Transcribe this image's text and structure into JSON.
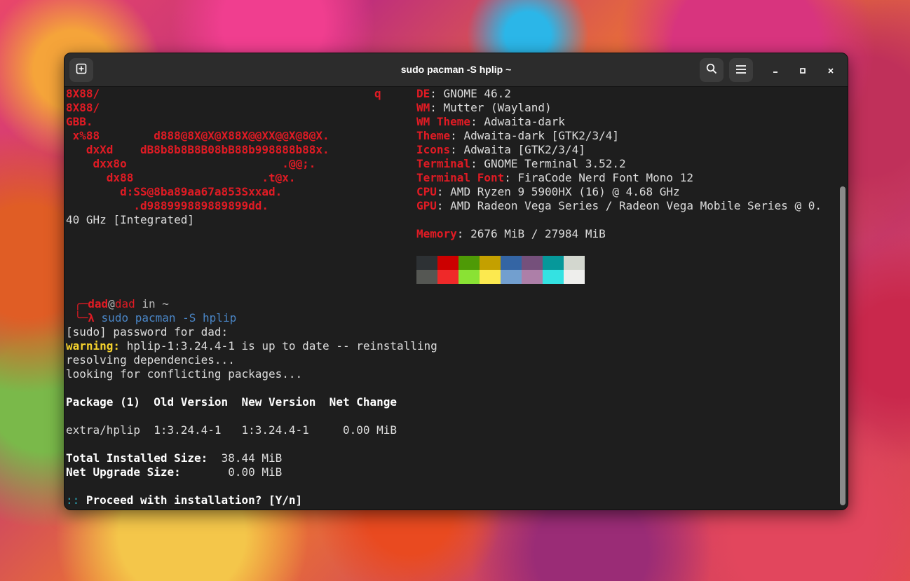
{
  "window": {
    "title": "sudo pacman -S hplip ~",
    "icons": [
      "new-tab-icon",
      "search-icon",
      "menu-icon",
      "minimize-icon",
      "maximize-icon",
      "close-icon"
    ]
  },
  "ascii_art": [
    "8X88/",
    "8X88/",
    "GBB.",
    " x%88        d888@8X@X@X88X@@XX@@X@8@X.",
    "   dxXd    dB8b8b8B8B08bB88b998888b88x.",
    "    dxx8o                       .@@;.",
    "      dx88                   .t@x.",
    "        d:SS@8ba89aa67a853Sxxad.",
    "          .d988999889889899dd."
  ],
  "ascii_q": "q",
  "wrapped_line": "40 GHz [Integrated]",
  "sysinfo": [
    {
      "key": "DE",
      "value": "GNOME 46.2"
    },
    {
      "key": "WM",
      "value": "Mutter (Wayland)"
    },
    {
      "key": "WM Theme",
      "value": "Adwaita-dark"
    },
    {
      "key": "Theme",
      "value": "Adwaita-dark [GTK2/3/4]"
    },
    {
      "key": "Icons",
      "value": "Adwaita [GTK2/3/4]"
    },
    {
      "key": "Terminal",
      "value": "GNOME Terminal 3.52.2"
    },
    {
      "key": "Terminal Font",
      "value": "FiraCode Nerd Font Mono 12"
    },
    {
      "key": "CPU",
      "value": "AMD Ryzen 9 5900HX (16) @ 4.68 GHz"
    },
    {
      "key": "GPU",
      "value": "AMD Radeon Vega Series / Radeon Vega Mobile Series @ 0."
    },
    {
      "key": "Memory",
      "value": "2676 MiB / 27984 MiB"
    }
  ],
  "palette_top": [
    "#2d3134",
    "#cc0000",
    "#4e9a06",
    "#c4a000",
    "#3465a4",
    "#75507b",
    "#06989a",
    "#d3d7cf"
  ],
  "palette_bottom": [
    "#555753",
    "#ef2929",
    "#8ae234",
    "#fce94f",
    "#729fcf",
    "#ad7fa8",
    "#34e2e2",
    "#eeeeec"
  ],
  "prompt": {
    "user": "dad",
    "at": "@",
    "host": "dad",
    "in": " in ",
    "dir": "~",
    "lambda": "λ",
    "command": "sudo pacman -S hplip"
  },
  "output": {
    "sudo": "[sudo] password for dad:",
    "warning_label": "warning:",
    "warning_text": " hplip-1:3.24.4-1 is up to date -- reinstalling",
    "resolving": "resolving dependencies...",
    "looking": "looking for conflicting packages...",
    "table_header": "Package (1)  Old Version  New Version  Net Change",
    "table_row": "extra/hplip  1:3.24.4-1   1:3.24.4-1     0.00 MiB",
    "total_label": "Total Installed Size:",
    "total_value": "  38.44 MiB",
    "upgrade_label": "Net Upgrade Size:",
    "upgrade_value": "       0.00 MiB",
    "proceed_prefix": "::",
    "proceed_text": " Proceed with installation? [Y/n]"
  }
}
